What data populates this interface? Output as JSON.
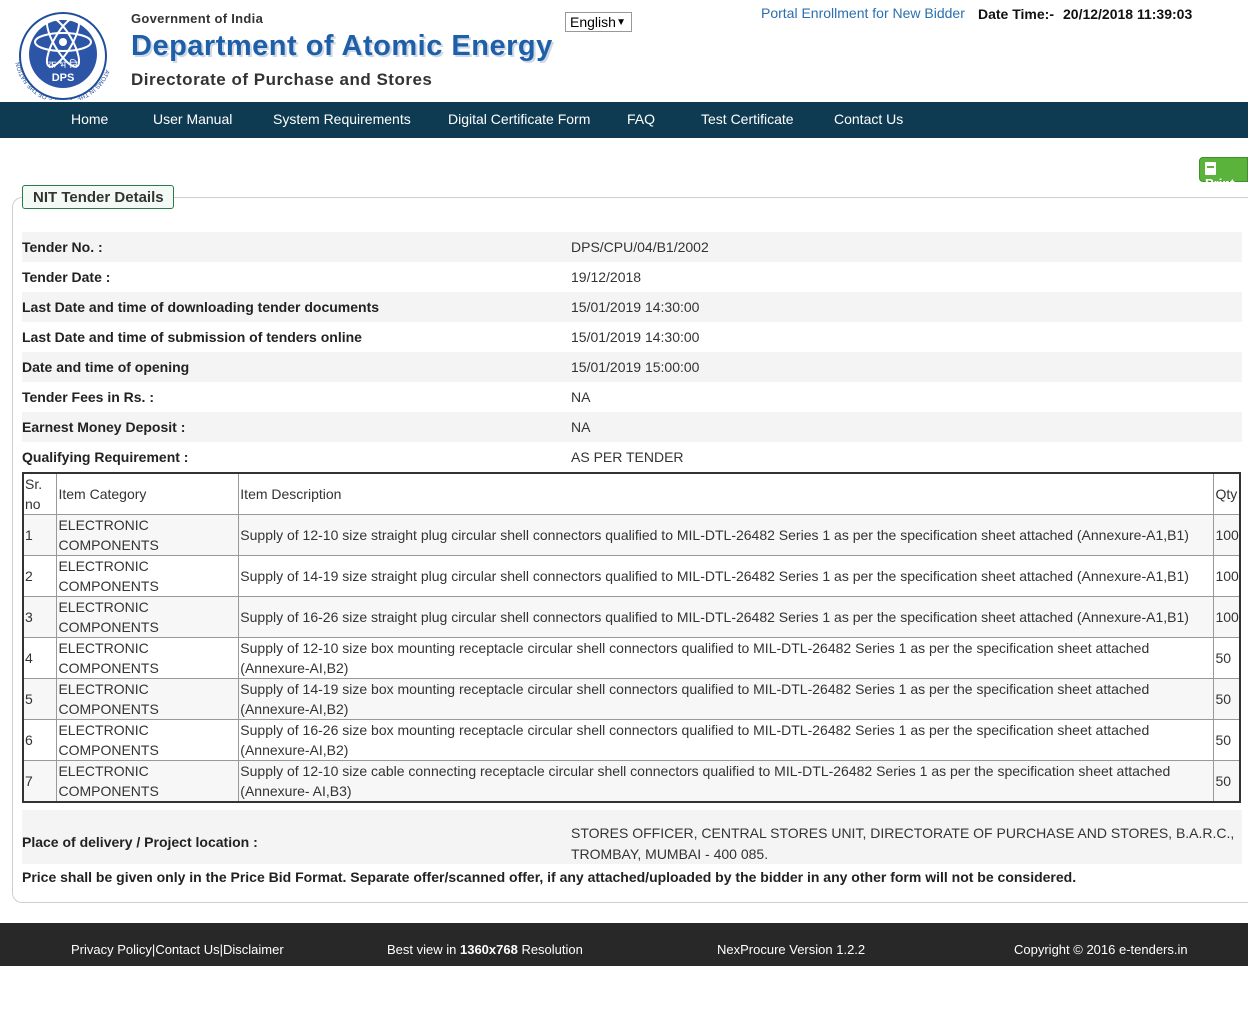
{
  "header": {
    "logo_tagline": "ATOMS IN THE SERVICE OF THE NATION",
    "logo_hindi": "क्र भं नि",
    "logo_abbr": "DPS",
    "gov_label": "Government of India",
    "dept_name": "Department of Atomic Energy",
    "directorate": "Directorate of Purchase and Stores",
    "language": "English",
    "portal_link": "Portal Enrollment for New Bidder",
    "datetime_label": "Date Time:-",
    "datetime_value": "20/12/2018 11:39:03"
  },
  "nav": {
    "items": [
      "Home",
      "User Manual",
      "System Requirements",
      "Digital Certificate Form",
      "FAQ",
      "Test Certificate",
      "Contact Us"
    ]
  },
  "print_label": "Print",
  "panel_title": "NIT Tender Details",
  "details": [
    {
      "label": "Tender No. :",
      "value": "DPS/CPU/04/B1/2002"
    },
    {
      "label": "Tender Date :",
      "value": "19/12/2018"
    },
    {
      "label": "Last Date and time of downloading tender documents",
      "value": "15/01/2019 14:30:00"
    },
    {
      "label": "Last Date and time of submission of tenders online",
      "value": "15/01/2019 14:30:00"
    },
    {
      "label": "Date and time of opening",
      "value": "15/01/2019 15:00:00"
    },
    {
      "label": "Tender Fees in Rs. :",
      "value": "NA"
    },
    {
      "label": "Earnest Money Deposit :",
      "value": "NA"
    },
    {
      "label": "Qualifying Requirement :",
      "value": "AS PER TENDER"
    }
  ],
  "items_table": {
    "headers": [
      "Sr. no",
      "Item Category",
      "Item Description",
      "Qty"
    ],
    "rows": [
      {
        "sr": "1",
        "category": "ELECTRONIC COMPONENTS",
        "description": "Supply of 12-10 size straight plug circular shell connectors qualified to MIL-DTL-26482 Series 1 as per the specification sheet attached (Annexure-A1,B1)",
        "qty": "100"
      },
      {
        "sr": "2",
        "category": "ELECTRONIC COMPONENTS",
        "description": "Supply of 14-19 size straight plug circular shell connectors qualified to MIL-DTL-26482 Series 1 as per the specification sheet attached (Annexure-A1,B1)",
        "qty": "100"
      },
      {
        "sr": "3",
        "category": "ELECTRONIC COMPONENTS",
        "description": "Supply of 16-26 size straight plug circular shell connectors qualified to MIL-DTL-26482 Series 1 as per the specification sheet attached (Annexure-A1,B1)",
        "qty": "100"
      },
      {
        "sr": "4",
        "category": "ELECTRONIC COMPONENTS",
        "description": "Supply of 12-10 size box mounting receptacle circular shell connectors qualified to MIL-DTL-26482 Series 1 as per the specification sheet attached (Annexure-AI,B2)",
        "qty": "50"
      },
      {
        "sr": "5",
        "category": "ELECTRONIC COMPONENTS",
        "description": "Supply of 14-19 size box mounting receptacle circular shell connectors qualified to MIL-DTL-26482 Series 1 as per the specification sheet attached (Annexure-AI,B2)",
        "qty": "50"
      },
      {
        "sr": "6",
        "category": "ELECTRONIC COMPONENTS",
        "description": "Supply of 16-26 size box mounting receptacle circular shell connectors qualified to MIL-DTL-26482 Series 1 as per the specification sheet attached (Annexure-AI,B2)",
        "qty": "50"
      },
      {
        "sr": "7",
        "category": "ELECTRONIC COMPONENTS",
        "description": "Supply of 12-10 size cable connecting receptacle circular shell connectors qualified to MIL-DTL-26482 Series 1 as per the specification sheet attached (Annexure- AI,B3)",
        "qty": "50"
      }
    ]
  },
  "delivery": {
    "label": "Place of delivery / Project location :",
    "value": "STORES OFFICER, CENTRAL STORES UNIT, DIRECTORATE OF PURCHASE AND STORES, B.A.R.C., TROMBAY, MUMBAI - 400 085."
  },
  "price_note": "Price shall be given only in the Price Bid Format. Separate offer/scanned offer, if any attached/uploaded by the bidder in any other form will not be considered.",
  "footer": {
    "policy_links": [
      "Privacy Policy",
      "Contact Us",
      "Disclaimer"
    ],
    "best_view_prefix": "Best view in ",
    "best_view_res": "1360x768",
    "best_view_suffix": " Resolution",
    "version": "NexProcure Version 1.2.2",
    "copyright": "Copyright © 2016 e-tenders.in"
  },
  "colors": {
    "nav_bg": "#0f3b52",
    "brand_blue": "#1f5fa8",
    "link_blue": "#2a6fb0",
    "print_green": "#5ab43c",
    "footer_bg": "#282828"
  }
}
